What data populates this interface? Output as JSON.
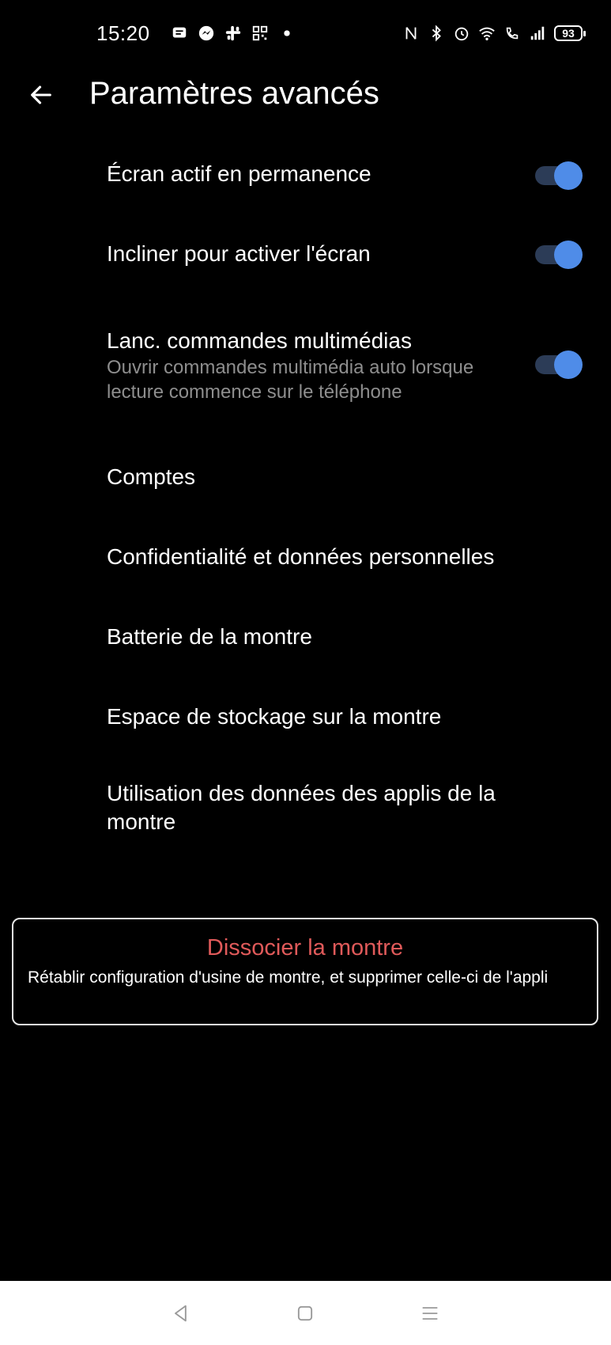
{
  "status_bar": {
    "time": "15:20",
    "battery_level": "93",
    "left_icons": [
      "message-icon",
      "messenger-icon",
      "slack-icon",
      "qr-code-icon",
      "dot-icon"
    ],
    "right_icons": [
      "nfc-icon",
      "bluetooth-icon",
      "alarm-icon",
      "wifi-icon",
      "wifi-call-icon",
      "signal-icon",
      "battery-icon"
    ]
  },
  "header": {
    "title": "Paramètres avancés"
  },
  "settings": [
    {
      "title": "Écran actif en permanence",
      "toggle_on": true
    },
    {
      "title": "Incliner pour activer l'écran",
      "toggle_on": true
    },
    {
      "title": "Lanc. commandes multimédias",
      "subtitle": "Ouvrir commandes multimédia auto lorsque lecture commence sur le téléphone",
      "toggle_on": true
    },
    {
      "title": "Comptes"
    },
    {
      "title": "Confidentialité et données personnelles"
    },
    {
      "title": "Batterie de la montre"
    },
    {
      "title": "Espace de stockage sur la montre"
    },
    {
      "title": "Utilisation des données des applis de la montre"
    }
  ],
  "unpair": {
    "title": "Dissocier la montre",
    "description": "Rétablir configuration d'usine de montre, et supprimer celle-ci de l'appli"
  },
  "nav_bar": {
    "buttons": [
      "back-nav-icon",
      "home-nav-icon",
      "menu-nav-icon"
    ]
  },
  "colors": {
    "background": "#000000",
    "toggle_thumb": "#4f8ce8",
    "toggle_track": "#2c3c57",
    "danger": "#e05a5a",
    "subtitle": "#8e8e8e"
  }
}
